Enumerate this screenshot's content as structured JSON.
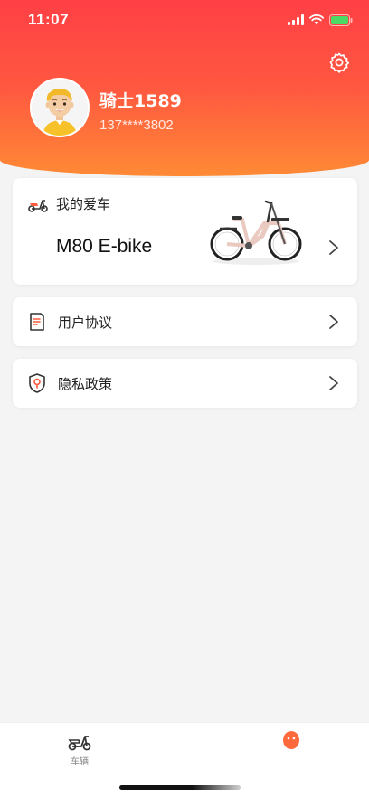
{
  "status_bar": {
    "time": "11:07"
  },
  "profile": {
    "name": "骑士1589",
    "phone": "137****3802"
  },
  "vehicle_card": {
    "title": "我的爱车",
    "model": "M80 E-bike"
  },
  "menu": [
    {
      "label": "用户协议",
      "icon": "document-icon"
    },
    {
      "label": "隐私政策",
      "icon": "privacy-shield-icon"
    }
  ],
  "tab_bar": {
    "vehicle_label": "车辆"
  },
  "colors": {
    "header_top": "#ff3f45",
    "header_bottom": "#ff8a35",
    "accent": "#ff5a3c"
  }
}
